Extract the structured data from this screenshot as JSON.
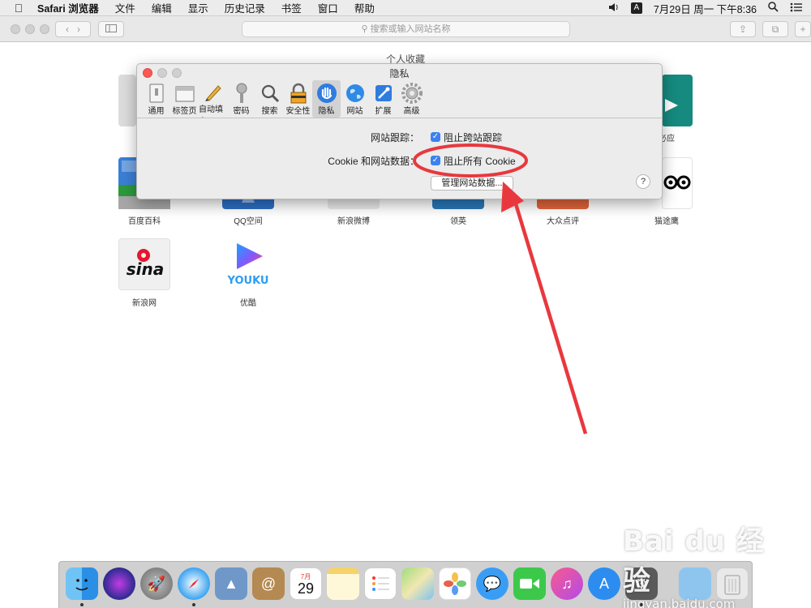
{
  "menubar": {
    "items": [
      "Safari 浏览器",
      "文件",
      "编辑",
      "显示",
      "历史记录",
      "书签",
      "窗口",
      "帮助"
    ],
    "input_source": "A",
    "clock": "7月29日 周一 下午8:36"
  },
  "toolbar": {
    "search_placeholder": "搜索或输入网站名称"
  },
  "page": {
    "favorites_title": "个人收藏",
    "tiles": [
      {
        "label": "必应",
        "color": "#168a7e"
      },
      {
        "label": "百度百科",
        "color": "#3b7fd6"
      },
      {
        "label": "QQ空间",
        "color": "#2b6ec4"
      },
      {
        "label": "新浪微博",
        "color": "#e9e9e9"
      },
      {
        "label": "领英",
        "color": "#2a77b8"
      },
      {
        "label": "大众点评",
        "color": "#e2643a"
      },
      {
        "label": "猫途鹰",
        "color": "#ffffff"
      },
      {
        "label": "新浪网",
        "color": "#f0f0f0"
      },
      {
        "label": "优酷",
        "color": "#ffffff"
      }
    ]
  },
  "prefs": {
    "title": "隐私",
    "tabs": [
      {
        "label": "通用",
        "icon": "general-icon"
      },
      {
        "label": "标签页",
        "icon": "tabs-icon"
      },
      {
        "label": "自动填充",
        "icon": "pencil-icon"
      },
      {
        "label": "密码",
        "icon": "key-icon"
      },
      {
        "label": "搜索",
        "icon": "magnifier-icon"
      },
      {
        "label": "安全性",
        "icon": "lock-icon"
      },
      {
        "label": "隐私",
        "icon": "hand-icon"
      },
      {
        "label": "网站",
        "icon": "globe-icon"
      },
      {
        "label": "扩展",
        "icon": "puzzle-icon"
      },
      {
        "label": "高级",
        "icon": "gear-icon"
      }
    ],
    "active_tab": "隐私",
    "tracking_label": "网站跟踪：",
    "tracking_checkbox": "阻止跨站跟踪",
    "cookie_label": "Cookie 和网站数据：",
    "cookie_checkbox": "阻止所有 Cookie",
    "manage_button": "管理网站数据...",
    "help": "?"
  },
  "annotation_color": "#e8383e",
  "dock": {
    "icons": [
      "finder-icon",
      "siri-icon",
      "launchpad-icon",
      "safari-icon",
      "preview-icon",
      "contacts-icon",
      "calendar-icon",
      "notes-icon",
      "reminders-icon",
      "maps-icon",
      "photos-icon",
      "messages-icon",
      "facetime-icon",
      "music-icon",
      "appstore-icon",
      "system-prefs-icon",
      "downloads-icon",
      "trash-icon"
    ],
    "calendar_month": "7月",
    "calendar_day": "29"
  },
  "watermark": {
    "brand": "Bai du 经验",
    "site": "jingyan.baidu.com"
  }
}
